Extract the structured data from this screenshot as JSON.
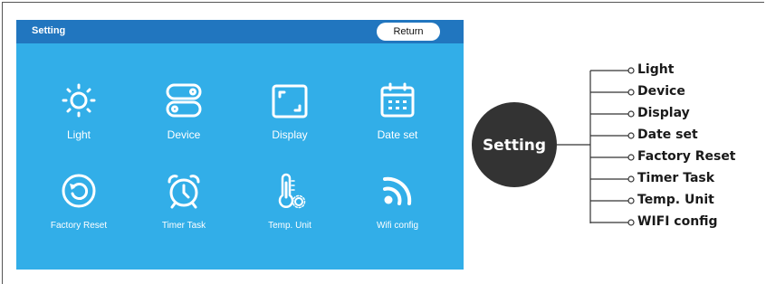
{
  "screen": {
    "title": "Setting",
    "return_label": "Return",
    "tiles": [
      {
        "label": "Light",
        "icon": "sun-icon"
      },
      {
        "label": "Device",
        "icon": "toggle-switches-icon"
      },
      {
        "label": "Display",
        "icon": "screen-frame-icon"
      },
      {
        "label": "Date set",
        "icon": "calendar-icon"
      },
      {
        "label": "Factory Reset",
        "icon": "reset-arrow-icon"
      },
      {
        "label": "Timer Task",
        "icon": "alarm-clock-icon"
      },
      {
        "label": "Temp. Unit",
        "icon": "thermometer-icon"
      },
      {
        "label": "Wifi config",
        "icon": "wifi-icon"
      }
    ],
    "colors": {
      "header": "#2176bf",
      "body": "#32aee8",
      "icon": "#ffffff"
    }
  },
  "diagram": {
    "hub_label": "Setting",
    "hub_color": "#333333",
    "branches": [
      "Light",
      "Device",
      "Display",
      "Date set",
      "Factory Reset",
      "Timer Task",
      "Temp. Unit",
      "WIFI config"
    ]
  }
}
